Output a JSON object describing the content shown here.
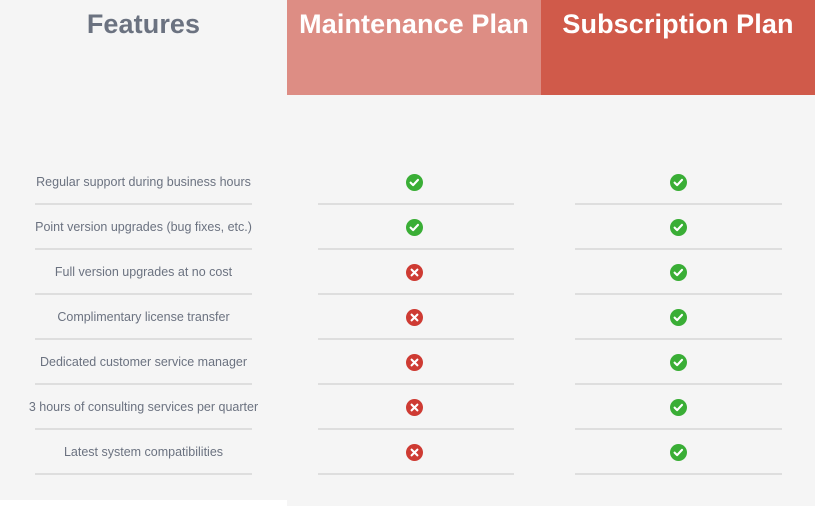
{
  "table": {
    "columns": [
      {
        "key": "features",
        "label": "Features",
        "style": "dark",
        "header_bg": "transparent"
      },
      {
        "key": "plan_a",
        "label": "Maintenance Plan",
        "style": "light",
        "header_bg": "#dd8d84"
      },
      {
        "key": "plan_b",
        "label": "Subscription Plan",
        "style": "light",
        "header_bg": "#d05a4a"
      }
    ],
    "icons": {
      "included": "check-circle-icon",
      "excluded": "cross-circle-icon",
      "included_color": "#3aae36",
      "excluded_color": "#ce3b33"
    },
    "rows": [
      {
        "feature": "Regular support during business hours",
        "plan_a": "included",
        "plan_b": "included"
      },
      {
        "feature": "Point version upgrades (bug fixes, etc.)",
        "plan_a": "included",
        "plan_b": "included"
      },
      {
        "feature": "Full version upgrades at no cost",
        "plan_a": "excluded",
        "plan_b": "included"
      },
      {
        "feature": "Complimentary license transfer",
        "plan_a": "excluded",
        "plan_b": "included"
      },
      {
        "feature": "Dedicated customer service manager",
        "plan_a": "excluded",
        "plan_b": "included"
      },
      {
        "feature": "3 hours of consulting services per quarter",
        "plan_a": "excluded",
        "plan_b": "included"
      },
      {
        "feature": "Latest system compatibilities",
        "plan_a": "excluded",
        "plan_b": "included"
      }
    ]
  }
}
